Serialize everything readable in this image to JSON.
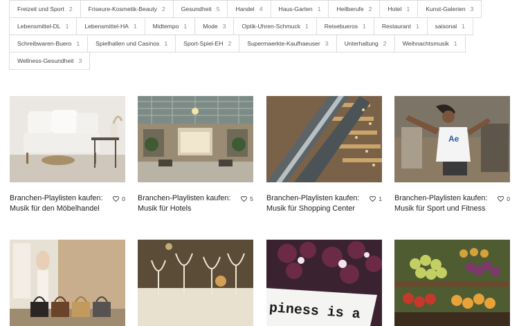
{
  "tags": [
    [
      {
        "label": "Freizeit und Sport",
        "count": "2"
      },
      {
        "label": "Friseure-Kosmetik-Beauty",
        "count": "2"
      },
      {
        "label": "Gesundheit",
        "count": "5"
      },
      {
        "label": "Handel",
        "count": "4"
      },
      {
        "label": "Haus-Garten",
        "count": "1"
      },
      {
        "label": "Heilberufe",
        "count": "2"
      },
      {
        "label": "Hotel",
        "count": "1"
      },
      {
        "label": "Kunst-Galerien",
        "count": "3"
      }
    ],
    [
      {
        "label": "Lebensmittel-DL",
        "count": "1"
      },
      {
        "label": "Lebensmittel-HA",
        "count": "1"
      },
      {
        "label": "Midtempo",
        "count": "1"
      },
      {
        "label": "Mode",
        "count": "3"
      },
      {
        "label": "Optik-Uhren-Schmuck",
        "count": "1"
      },
      {
        "label": "Reisebueros",
        "count": "1"
      },
      {
        "label": "Restaurant",
        "count": "1"
      },
      {
        "label": "saisonal",
        "count": "1"
      }
    ],
    [
      {
        "label": "Schreibwaren-Buero",
        "count": "1"
      },
      {
        "label": "Spielhallen und Casinos",
        "count": "1"
      },
      {
        "label": "Sport-Spiel-EH",
        "count": "2"
      },
      {
        "label": "Supermaerkte-Kaufhaeuser",
        "count": "3"
      },
      {
        "label": "Unterhaltung",
        "count": "2"
      },
      {
        "label": "Weihnachtsmusik",
        "count": "1"
      }
    ],
    [
      {
        "label": "Wellness-Gesundheit",
        "count": "3"
      }
    ]
  ],
  "cards": [
    {
      "title": "Branchen-Playlisten kaufen: Musik für den Möbelhandel",
      "likes": "0",
      "image": "living-room"
    },
    {
      "title": "Branchen-Playlisten kaufen: Musik für Hotels",
      "likes": "5",
      "image": "hotel-lobby"
    },
    {
      "title": "Branchen-Playlisten kaufen: Musik für Shopping Center",
      "likes": "1",
      "image": "escalator"
    },
    {
      "title": "Branchen-Playlisten kaufen: Musik für Sport und Fitness",
      "likes": "0",
      "image": "dancer"
    },
    {
      "title": "",
      "likes": "",
      "image": "handbags"
    },
    {
      "title": "",
      "likes": "",
      "image": "wine-glasses"
    },
    {
      "title": "",
      "likes": "",
      "image": "happiness-sign",
      "sign_text": "piness is a"
    },
    {
      "title": "",
      "likes": "",
      "image": "fruit-market"
    }
  ]
}
